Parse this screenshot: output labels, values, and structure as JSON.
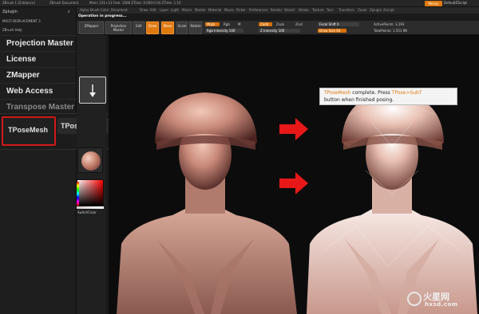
{
  "titlebar": {
    "items": [
      "ZBrush 1.2[nblance]",
      "ZBrush Document",
      "Mem: 231+13 Free: 1008 ZTime: 0.000:0.04 ZTime: 1.10"
    ],
    "menus_label": "Menus",
    "script_label": "DefaultZScript"
  },
  "leftpanel": {
    "header": "Zplugin",
    "pin": "c",
    "sub1": "MULTI DISPLACEMENT 3",
    "sub2": "ZBrush Help",
    "items": [
      "Projection Master",
      "License",
      "ZMapper",
      "Web Access",
      "Transpose Master"
    ],
    "tpose_mesh": "TPoseMesh",
    "tpose_subt": "TPose▸SubT"
  },
  "menustrip": {
    "items": [
      "Alpha",
      "Brush",
      "Color",
      "Document",
      "Draw",
      "Edit",
      "Layer",
      "Light",
      "Macro",
      "Marker",
      "Material",
      "Movie",
      "Picker",
      "Preferences",
      "Render",
      "Stencil",
      "Stroke",
      "Texture",
      "Tool",
      "Transform",
      "Zoom",
      "Zplugin",
      "Zscript"
    ]
  },
  "progress_tip": "Operation in progress...",
  "toolbar": {
    "buttons": [
      "ZMapper",
      "Projection Master",
      "Edit",
      "Draw",
      "Move",
      "Scale",
      "Rotate"
    ],
    "mrgb_label": "Mrgb",
    "rgb_label": "Rgb",
    "m_label": "M",
    "rgb_intensity": "Rgb Intensity 100",
    "zadd_label": "Zadd",
    "zsub_label": "Zsub",
    "zcut_label": "Zcut",
    "z_intensity": "Z Intensity 100",
    "focal_shift": "Focal Shift 0",
    "draw_size": "Draw Size 64",
    "active_points": "ActivePoints: 3,193",
    "total_points": "TotalPoints: 1.551 Mil"
  },
  "tool_strip": {
    "switch_color": "SwitchColor"
  },
  "tooltip": {
    "line1_a": "TPoseMesh",
    "line1_b": " complete.  Press ",
    "line1_c": "TPose>SubT",
    "line2": "button when finished posing."
  },
  "watermark": {
    "line1": "火星网",
    "line2": "hxsd.com"
  },
  "colors": {
    "accent": "#e07a10",
    "highlight_box": "#d21818",
    "arrow": "#e81818",
    "clay": "#c88a7a"
  }
}
